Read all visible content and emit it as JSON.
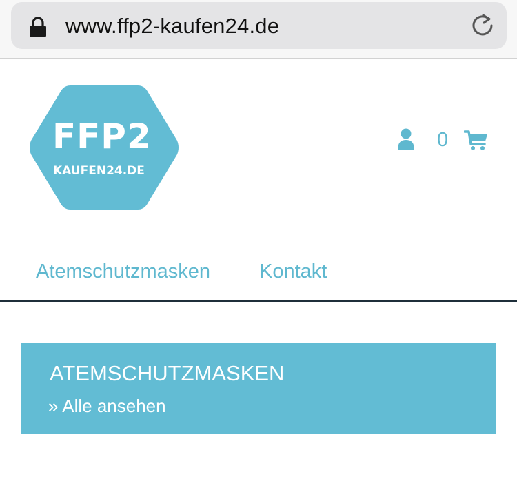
{
  "browser": {
    "url": "www.ffp2-kaufen24.de",
    "lock_icon": "lock-icon",
    "reload_icon": "reload-icon"
  },
  "header": {
    "logo": {
      "main_text": "FFP2",
      "sub_text": "KAUFEN24.DE",
      "color": "#62bcd4"
    },
    "account_icon": "user-icon",
    "cart_count": "0",
    "cart_icon": "shopping-cart-icon"
  },
  "nav": {
    "items": [
      {
        "label": "Atemschutzmasken"
      },
      {
        "label": "Kontakt"
      }
    ]
  },
  "category": {
    "title": "ATEMSCHUTZMASKEN",
    "link_label": "» Alle ansehen"
  },
  "colors": {
    "accent": "#5fb8cf",
    "banner_bg": "#62bcd4",
    "nav_divider": "#1f2f3a"
  }
}
